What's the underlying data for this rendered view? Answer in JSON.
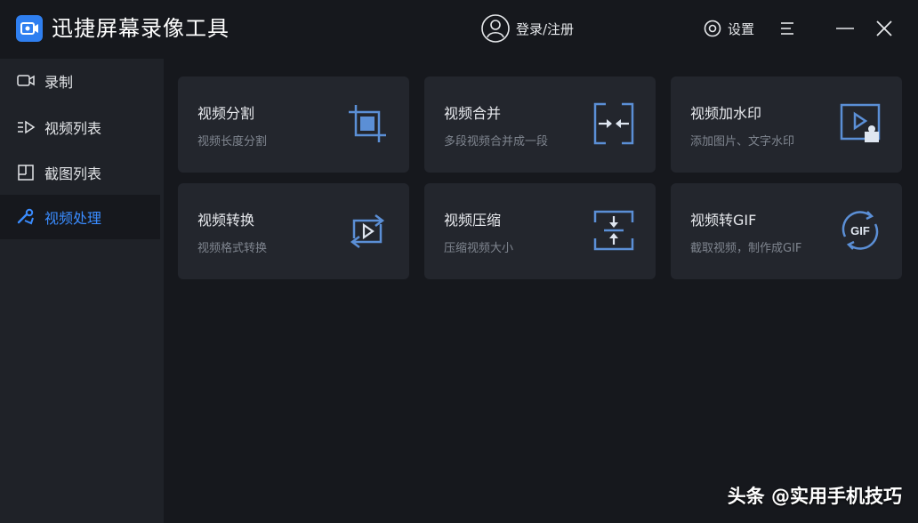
{
  "app": {
    "title": "迅捷屏幕录像工具"
  },
  "header": {
    "login_label": "登录/注册",
    "settings_label": "设置"
  },
  "sidebar": {
    "items": [
      {
        "label": "录制",
        "icon": "camera-icon"
      },
      {
        "label": "视频列表",
        "icon": "video-list-icon"
      },
      {
        "label": "截图列表",
        "icon": "screenshot-list-icon"
      },
      {
        "label": "视频处理",
        "icon": "video-process-icon",
        "active": true
      }
    ]
  },
  "cards": [
    {
      "title": "视频分割",
      "desc": "视频长度分割",
      "icon": "crop-icon"
    },
    {
      "title": "视频合并",
      "desc": "多段视频合并成一段",
      "icon": "merge-icon"
    },
    {
      "title": "视频加水印",
      "desc": "添加图片、文字水印",
      "icon": "watermark-icon"
    },
    {
      "title": "视频转换",
      "desc": "视频格式转换",
      "icon": "convert-icon"
    },
    {
      "title": "视频压缩",
      "desc": "压缩视频大小",
      "icon": "compress-icon"
    },
    {
      "title": "视频转GIF",
      "desc": "截取视频，制作成GIF",
      "icon": "gif-icon"
    }
  ],
  "watermark": "头条 @实用手机技巧",
  "colors": {
    "accent": "#3a8cff",
    "icon_blue": "#5b8fd6",
    "card_bg": "#23262d",
    "sidebar_bg": "#1f2228",
    "app_bg": "#16181d"
  }
}
